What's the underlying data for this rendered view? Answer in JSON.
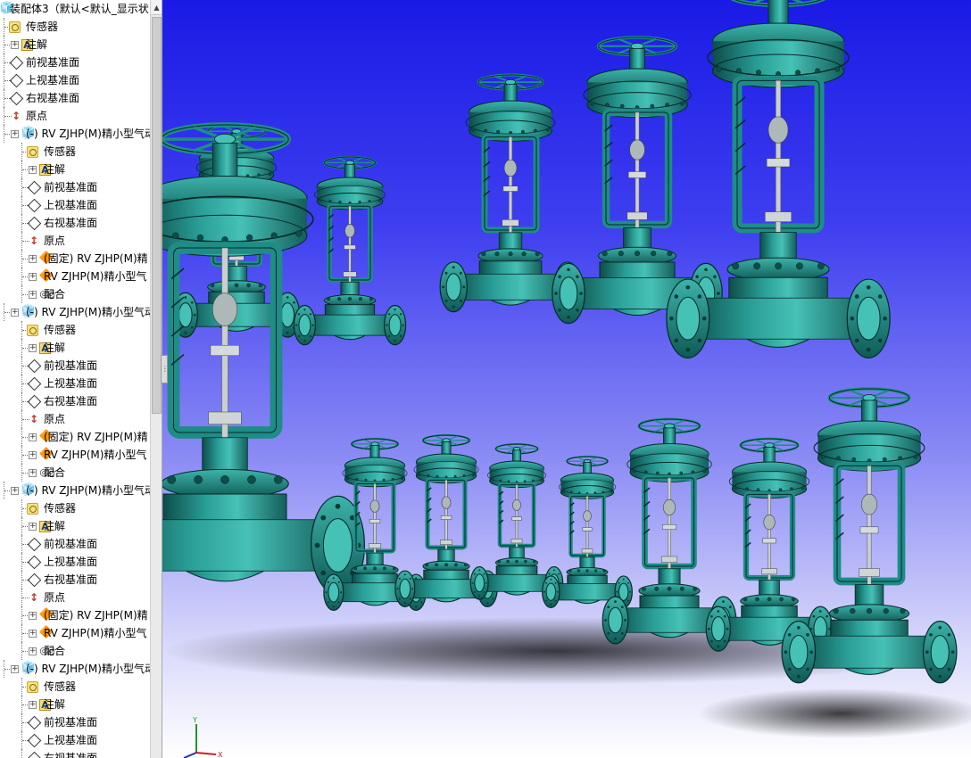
{
  "feature_tree": {
    "root_label": "装配体3（默认<默认_显示状",
    "rows": [
      {
        "indent": 1,
        "icon": "sensor-icon",
        "label": "传感器",
        "expandable": false
      },
      {
        "indent": 1,
        "icon": "annotation-icon",
        "label": "注解",
        "expandable": true
      },
      {
        "indent": 1,
        "icon": "plane-icon",
        "label": "前视基准面",
        "expandable": false
      },
      {
        "indent": 1,
        "icon": "plane-icon",
        "label": "上视基准面",
        "expandable": false
      },
      {
        "indent": 1,
        "icon": "plane-icon",
        "label": "右视基准面",
        "expandable": false
      },
      {
        "indent": 1,
        "icon": "origin-icon",
        "label": "原点",
        "expandable": false
      },
      {
        "indent": 1,
        "icon": "subassembly-icon",
        "label": "(-) RV ZJHP(M)精小型气动",
        "expandable": true
      },
      {
        "indent": 2,
        "icon": "sensor-icon",
        "label": "传感器",
        "expandable": false
      },
      {
        "indent": 2,
        "icon": "annotation-icon",
        "label": "注解",
        "expandable": true
      },
      {
        "indent": 2,
        "icon": "plane-icon",
        "label": "前视基准面",
        "expandable": false
      },
      {
        "indent": 2,
        "icon": "plane-icon",
        "label": "上视基准面",
        "expandable": false
      },
      {
        "indent": 2,
        "icon": "plane-icon",
        "label": "右视基准面",
        "expandable": false
      },
      {
        "indent": 2,
        "icon": "origin-icon",
        "label": "原点",
        "expandable": false
      },
      {
        "indent": 2,
        "icon": "part-icon",
        "label": "(固定) RV ZJHP(M)精",
        "expandable": true
      },
      {
        "indent": 2,
        "icon": "part-icon",
        "label": "RV ZJHP(M)精小型气",
        "expandable": true
      },
      {
        "indent": 2,
        "icon": "mate-icon",
        "label": "配合",
        "expandable": true
      },
      {
        "indent": 1,
        "icon": "subassembly-icon",
        "label": "(-) RV ZJHP(M)精小型气动",
        "expandable": true
      },
      {
        "indent": 2,
        "icon": "sensor-icon",
        "label": "传感器",
        "expandable": false
      },
      {
        "indent": 2,
        "icon": "annotation-icon",
        "label": "注解",
        "expandable": true
      },
      {
        "indent": 2,
        "icon": "plane-icon",
        "label": "前视基准面",
        "expandable": false
      },
      {
        "indent": 2,
        "icon": "plane-icon",
        "label": "上视基准面",
        "expandable": false
      },
      {
        "indent": 2,
        "icon": "plane-icon",
        "label": "右视基准面",
        "expandable": false
      },
      {
        "indent": 2,
        "icon": "origin-icon",
        "label": "原点",
        "expandable": false
      },
      {
        "indent": 2,
        "icon": "part-icon",
        "label": "(固定) RV ZJHP(M)精",
        "expandable": true
      },
      {
        "indent": 2,
        "icon": "part-icon",
        "label": "RV ZJHP(M)精小型气",
        "expandable": true
      },
      {
        "indent": 2,
        "icon": "mate-icon",
        "label": "配合",
        "expandable": true
      },
      {
        "indent": 1,
        "icon": "subassembly-icon",
        "label": "(-) RV ZJHP(M)精小型气动",
        "expandable": true
      },
      {
        "indent": 2,
        "icon": "sensor-icon",
        "label": "传感器",
        "expandable": false
      },
      {
        "indent": 2,
        "icon": "annotation-icon",
        "label": "注解",
        "expandable": true
      },
      {
        "indent": 2,
        "icon": "plane-icon",
        "label": "前视基准面",
        "expandable": false
      },
      {
        "indent": 2,
        "icon": "plane-icon",
        "label": "上视基准面",
        "expandable": false
      },
      {
        "indent": 2,
        "icon": "plane-icon",
        "label": "右视基准面",
        "expandable": false
      },
      {
        "indent": 2,
        "icon": "origin-icon",
        "label": "原点",
        "expandable": false
      },
      {
        "indent": 2,
        "icon": "part-icon",
        "label": "(固定) RV ZJHP(M)精",
        "expandable": true
      },
      {
        "indent": 2,
        "icon": "part-icon",
        "label": "RV ZJHP(M)精小型气",
        "expandable": true
      },
      {
        "indent": 2,
        "icon": "mate-icon",
        "label": "配合",
        "expandable": true
      },
      {
        "indent": 1,
        "icon": "subassembly-icon",
        "label": "(-) RV ZJHP(M)精小型气动",
        "expandable": true
      },
      {
        "indent": 2,
        "icon": "sensor-icon",
        "label": "传感器",
        "expandable": false
      },
      {
        "indent": 2,
        "icon": "annotation-icon",
        "label": "注解",
        "expandable": true
      },
      {
        "indent": 2,
        "icon": "plane-icon",
        "label": "前视基准面",
        "expandable": false
      },
      {
        "indent": 2,
        "icon": "plane-icon",
        "label": "上视基准面",
        "expandable": false
      },
      {
        "indent": 2,
        "icon": "plane-icon",
        "label": "右视基准面",
        "expandable": false
      }
    ]
  },
  "viewport": {
    "background_top": "#1a1ae6",
    "background_bottom": "#ffffff",
    "valve_body_color": "#1f8c86",
    "valve_highlight_color": "#46c1b6",
    "valve_shadow_color": "#0d4d4a",
    "stem_color": "#c9cfcf",
    "triad_labels": {
      "x": "X",
      "y": "Y",
      "z": "Z"
    }
  }
}
